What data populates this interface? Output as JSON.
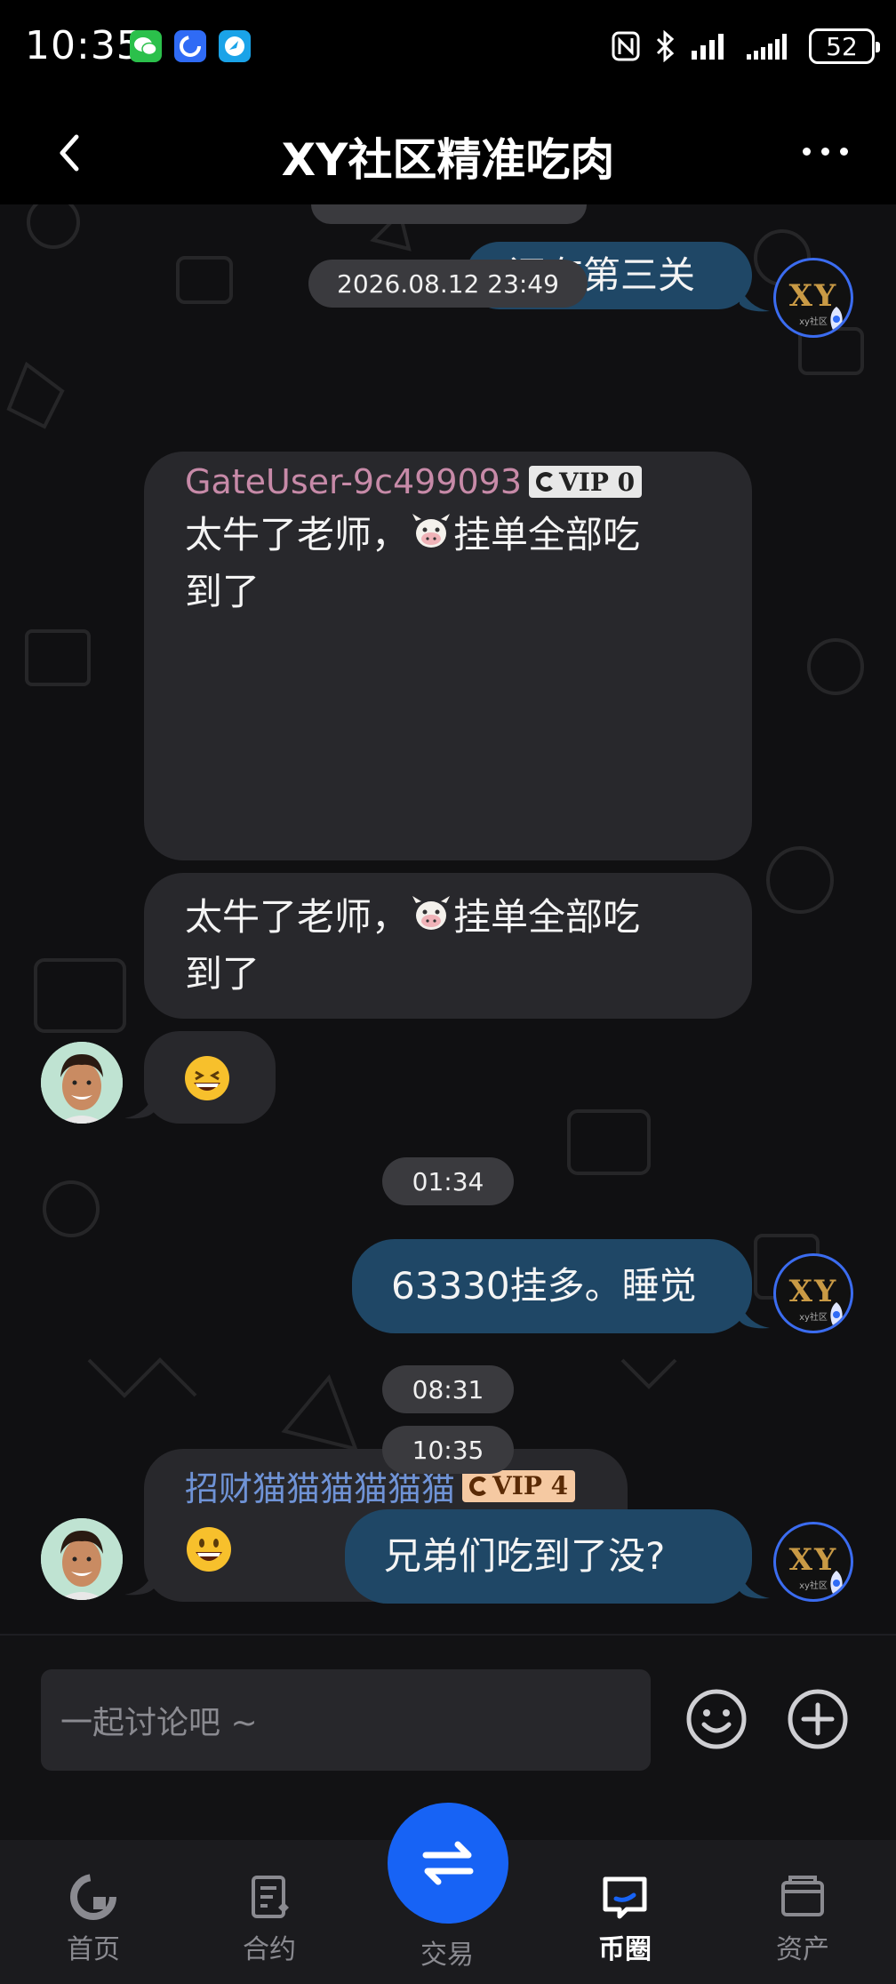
{
  "status_bar": {
    "time": "10:35",
    "battery": "52",
    "app_icons": [
      "wechat-icon",
      "gate-app-icon",
      "browser-icon"
    ],
    "right_icons": [
      "nfc-icon",
      "bluetooth-icon",
      "signal-icon",
      "signal-icon"
    ]
  },
  "header": {
    "title": "XY社区精准吃肉"
  },
  "messages": {
    "m1": {
      "text": "还有第三关"
    },
    "ts1": "2026.08.12 23:49",
    "m2": {
      "sender": "GateUser-9c499093",
      "vip": "VIP 0",
      "text1": "太牛了老师，",
      "text2": "挂单全部吃",
      "text3": "到了"
    },
    "m3": {
      "text1": "太牛了老师，",
      "text2": "挂单全部吃",
      "text3": "到了"
    },
    "m4": {
      "emoji": "grinning-squinting-face"
    },
    "ts2": "01:34",
    "m5": {
      "text": "63330挂多。睡觉"
    },
    "ts3": "08:31",
    "m6": {
      "sender": "招财猫猫猫猫猫猫",
      "vip": "VIP 4",
      "emoji": "grinning-face"
    },
    "ts4": "10:35",
    "m7": {
      "text": "兄弟们吃到了没?"
    }
  },
  "avatars": {
    "self_text": "XY",
    "self_subtext": "xy社区"
  },
  "input": {
    "placeholder": "一起讨论吧 ~"
  },
  "nav": {
    "home": "首页",
    "contract": "合约",
    "trade": "交易",
    "community": "币圈",
    "assets": "资产",
    "active": "community"
  },
  "colors": {
    "outgoing_bubble": "#1f4766",
    "incoming_bubble": "#28282c",
    "sender_gateuser": "#c78aa8",
    "sender_cat": "#6f93d6",
    "accent": "#1763f5"
  }
}
